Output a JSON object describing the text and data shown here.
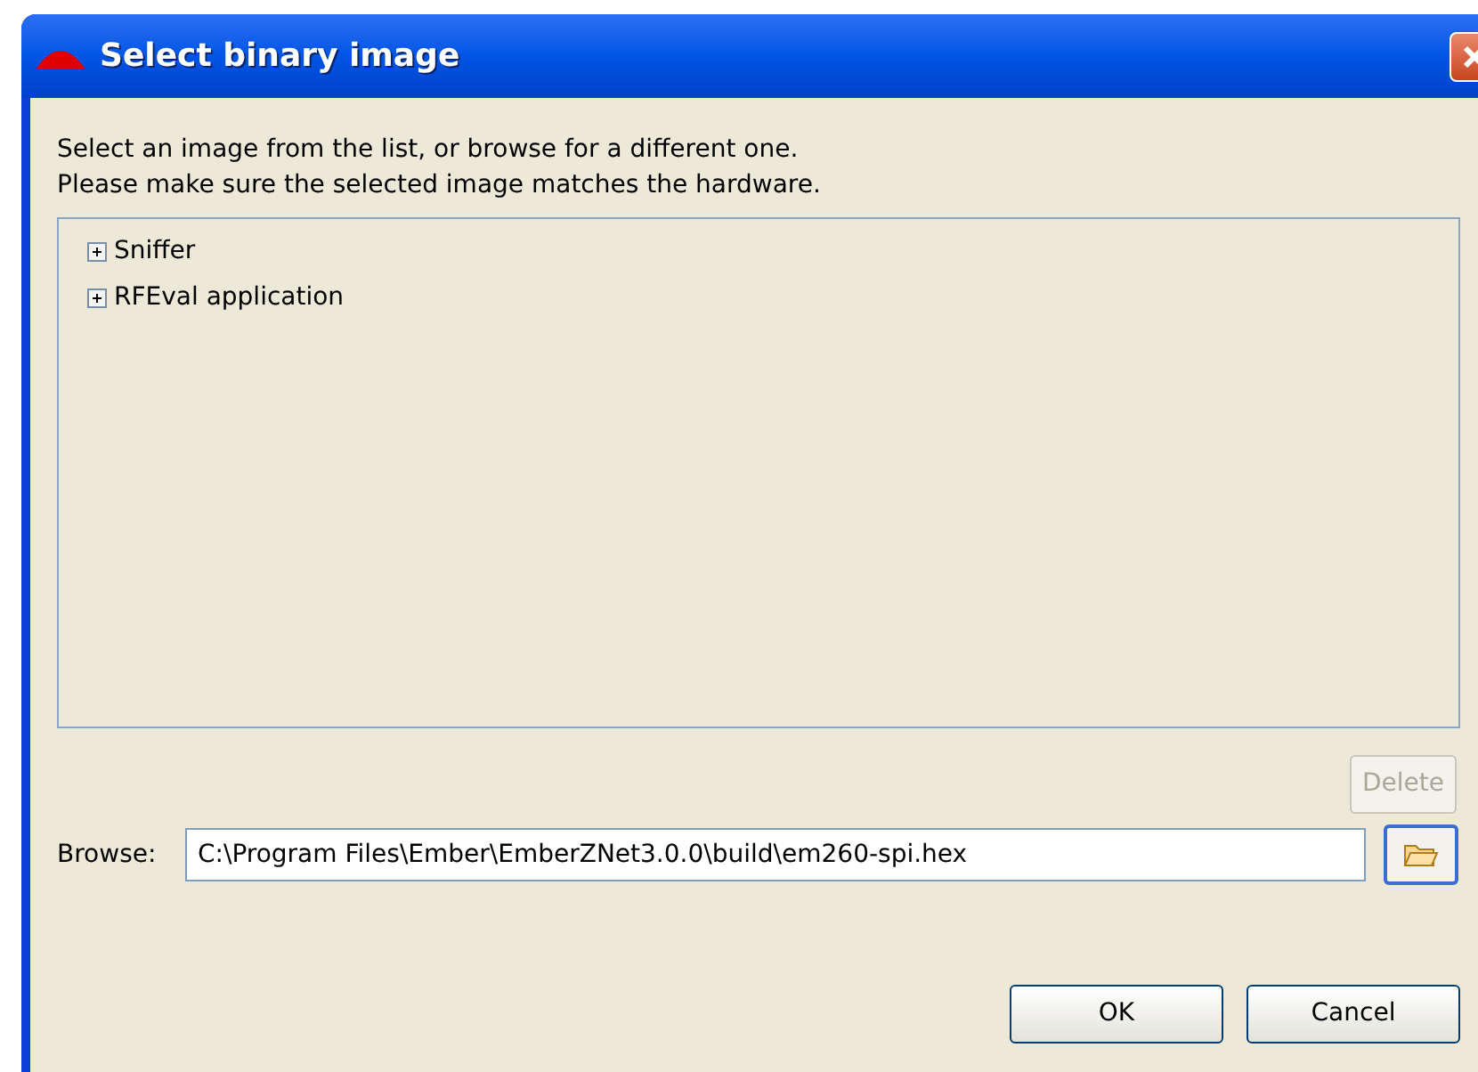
{
  "window": {
    "title": "Select binary image"
  },
  "instructions": [
    "Select an image from the list, or browse for a different one.",
    "Please make sure the selected image matches the hardware."
  ],
  "tree": {
    "items": [
      {
        "label": "Sniffer",
        "expanded": false
      },
      {
        "label": "RFEval application",
        "expanded": false
      }
    ]
  },
  "delete_button": {
    "label": "Delete",
    "disabled": true
  },
  "browse": {
    "label": "Browse:",
    "value": "C:\\Program Files\\Ember\\EmberZNet3.0.0\\build\\em260-spi.hex"
  },
  "buttons": [
    "OK",
    "Cancel"
  ]
}
